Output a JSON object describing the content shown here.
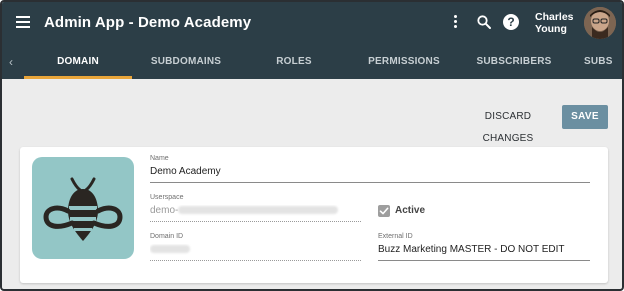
{
  "appbar": {
    "title": "Admin App - Demo Academy",
    "user_name": "Charles Young",
    "menu_icon": "hamburger-menu-icon",
    "more_icon": "more-vert-icon",
    "search_icon": "search-icon",
    "help_icon": "help-icon",
    "help_glyph": "?"
  },
  "tabs": [
    {
      "label": "DOMAIN",
      "active": true
    },
    {
      "label": "SUBDOMAINS",
      "active": false
    },
    {
      "label": "ROLES",
      "active": false
    },
    {
      "label": "PERMISSIONS",
      "active": false
    },
    {
      "label": "SUBSCRIBERS",
      "active": false
    },
    {
      "label": "SUBS",
      "active": false
    }
  ],
  "tab_scroll_left_glyph": "‹",
  "actions": {
    "discard_label": "DISCARD CHANGES",
    "save_label": "SAVE"
  },
  "domain": {
    "name_label": "Name",
    "name_value": "Demo Academy",
    "userspace_label": "Userspace",
    "userspace_value": "demo-",
    "domain_id_label": "Domain ID",
    "active_label": "Active",
    "active_checked": true,
    "external_id_label": "External ID",
    "external_id_value": "Buzz Marketing MASTER - DO NOT EDIT"
  },
  "colors": {
    "appbar": "#2c3e47",
    "tab_indicator": "#e9a53a",
    "save_button": "#6b8fa1",
    "logo_tile": "#93c6c6",
    "logo_mark": "#2a2622"
  }
}
